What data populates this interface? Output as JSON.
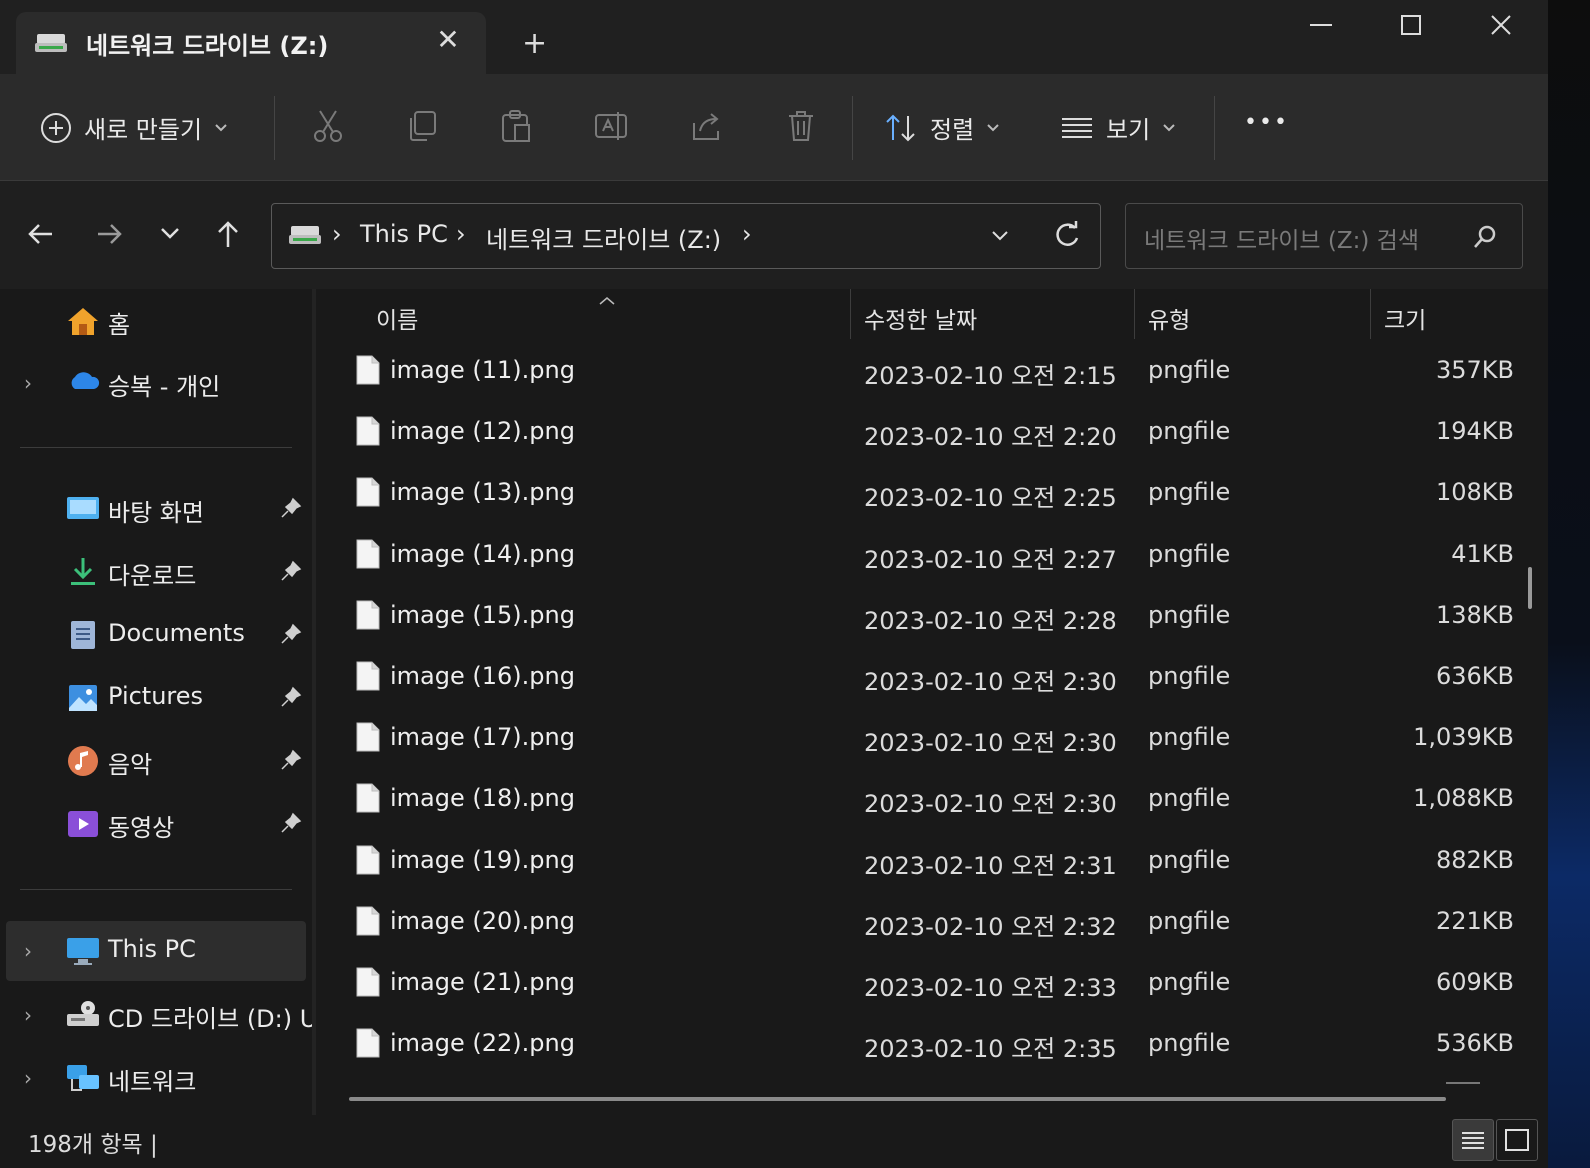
{
  "window": {
    "tab_title": "네트워크 드라이브 (Z:)",
    "tab_close": "✕",
    "new_tab": "+"
  },
  "toolbar": {
    "new_label": "새로 만들기",
    "sort_label": "정렬",
    "view_label": "보기",
    "more": "•••"
  },
  "address": {
    "segments": [
      "This PC",
      "네트워크 드라이브 (Z:)"
    ],
    "search_placeholder": "네트워크 드라이브 (Z:) 검색"
  },
  "nav": {
    "home": "홈",
    "onedrive": "승복 - 개인",
    "desktop": "바탕 화면",
    "downloads": "다운로드",
    "documents": "Documents",
    "pictures": "Pictures",
    "music": "음악",
    "videos": "동영상",
    "thispc": "This PC",
    "cddrive": "CD 드라이브 (D:) U",
    "network": "네트워크"
  },
  "columns": {
    "name": "이름",
    "date": "수정한 날짜",
    "type": "유형",
    "size": "크기"
  },
  "files": [
    {
      "name": "image (11).png",
      "date": "2023-02-10 오전 2:15",
      "type": "pngfile",
      "size": "357KB"
    },
    {
      "name": "image (12).png",
      "date": "2023-02-10 오전 2:20",
      "type": "pngfile",
      "size": "194KB"
    },
    {
      "name": "image (13).png",
      "date": "2023-02-10 오전 2:25",
      "type": "pngfile",
      "size": "108KB"
    },
    {
      "name": "image (14).png",
      "date": "2023-02-10 오전 2:27",
      "type": "pngfile",
      "size": "41KB"
    },
    {
      "name": "image (15).png",
      "date": "2023-02-10 오전 2:28",
      "type": "pngfile",
      "size": "138KB"
    },
    {
      "name": "image (16).png",
      "date": "2023-02-10 오전 2:30",
      "type": "pngfile",
      "size": "636KB"
    },
    {
      "name": "image (17).png",
      "date": "2023-02-10 오전 2:30",
      "type": "pngfile",
      "size": "1,039KB"
    },
    {
      "name": "image (18).png",
      "date": "2023-02-10 오전 2:30",
      "type": "pngfile",
      "size": "1,088KB"
    },
    {
      "name": "image (19).png",
      "date": "2023-02-10 오전 2:31",
      "type": "pngfile",
      "size": "882KB"
    },
    {
      "name": "image (20).png",
      "date": "2023-02-10 오전 2:32",
      "type": "pngfile",
      "size": "221KB"
    },
    {
      "name": "image (21).png",
      "date": "2023-02-10 오전 2:33",
      "type": "pngfile",
      "size": "609KB"
    },
    {
      "name": "image (22).png",
      "date": "2023-02-10 오전 2:35",
      "type": "pngfile",
      "size": "536KB"
    }
  ],
  "status": {
    "item_count": "198개 항목  |"
  },
  "colors": {
    "bg": "#191919",
    "toolbar": "#2b2b2b",
    "accent_folder": "#4fa3ff"
  },
  "icons": [
    "drive-icon",
    "close-icon",
    "plus-icon",
    "minimize-icon",
    "maximize-icon",
    "cut-icon",
    "copy-icon",
    "paste-icon",
    "rename-icon",
    "share-icon",
    "delete-icon",
    "sort-icon",
    "view-icon",
    "back-icon",
    "forward-icon",
    "up-icon",
    "refresh-icon",
    "search-icon",
    "file-icon",
    "pin-icon"
  ]
}
